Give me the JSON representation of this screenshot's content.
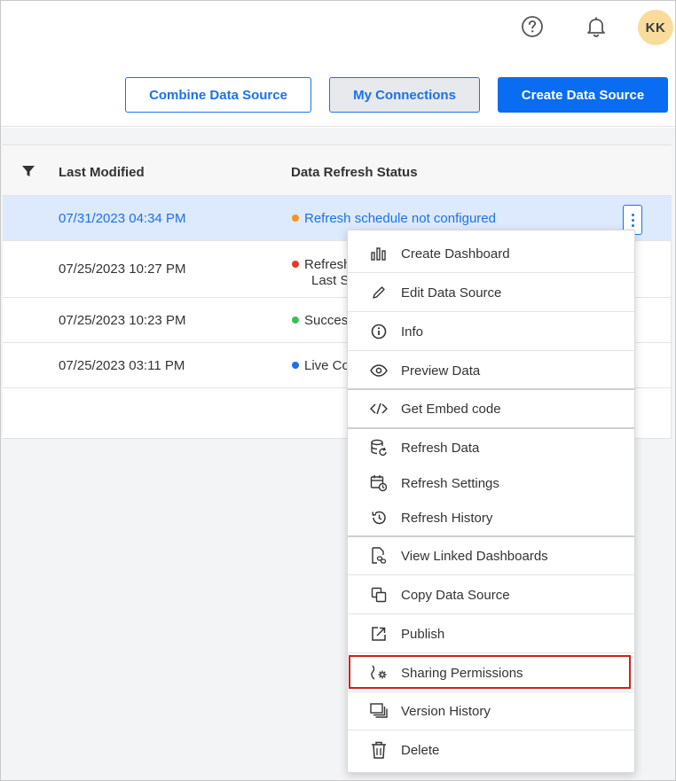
{
  "header": {
    "avatar_initials": "KK",
    "help_icon": "help-circle-icon",
    "notifications_icon": "bell-icon"
  },
  "actions": {
    "combine_label": "Combine Data Source",
    "connections_label": "My Connections",
    "create_label": "Create Data Source"
  },
  "table": {
    "filter_icon": "filter-icon",
    "columns": [
      "Last Modified",
      "Data Refresh Status"
    ],
    "rows": [
      {
        "date": "07/31/2023 04:34 PM",
        "status": "Refresh schedule not configured",
        "dot_color": "#f7941d",
        "selected": true
      },
      {
        "date": "07/25/2023 10:27 PM",
        "status": "Refresh",
        "status_line2": "Last S",
        "dot_color": "#e8362b",
        "selected": false
      },
      {
        "date": "07/25/2023 10:23 PM",
        "status": "Succes",
        "dot_color": "#3cc15a",
        "selected": false
      },
      {
        "date": "07/25/2023 03:11 PM",
        "status": "Live Co",
        "dot_color": "#1a73e8",
        "selected": false
      }
    ]
  },
  "menu": {
    "items": [
      {
        "label": "Create Dashboard",
        "icon": "bar-chart-icon"
      },
      {
        "label": "Edit Data Source",
        "icon": "pencil-icon"
      },
      {
        "label": "Info",
        "icon": "info-icon"
      },
      {
        "label": "Preview Data",
        "icon": "eye-icon"
      },
      {
        "label": "Get Embed code",
        "icon": "code-icon"
      },
      {
        "label": "Refresh Data",
        "icon": "database-refresh-icon"
      },
      {
        "label": "Refresh Settings",
        "icon": "calendar-clock-icon"
      },
      {
        "label": "Refresh History",
        "icon": "history-icon"
      },
      {
        "label": "View Linked Dashboards",
        "icon": "file-link-icon"
      },
      {
        "label": "Copy Data Source",
        "icon": "copy-icon"
      },
      {
        "label": "Publish",
        "icon": "publish-icon"
      },
      {
        "label": "Sharing Permissions",
        "icon": "share-settings-icon"
      },
      {
        "label": "Version History",
        "icon": "version-stack-icon"
      },
      {
        "label": "Delete",
        "icon": "trash-icon"
      }
    ],
    "highlighted": "Sharing Permissions"
  },
  "colors": {
    "accent": "#1a73e8",
    "primary_button": "#0a6cf0",
    "selected_row": "#dde9fc",
    "highlight_border": "#d0211c",
    "avatar_bg": "#f9dc9b"
  }
}
